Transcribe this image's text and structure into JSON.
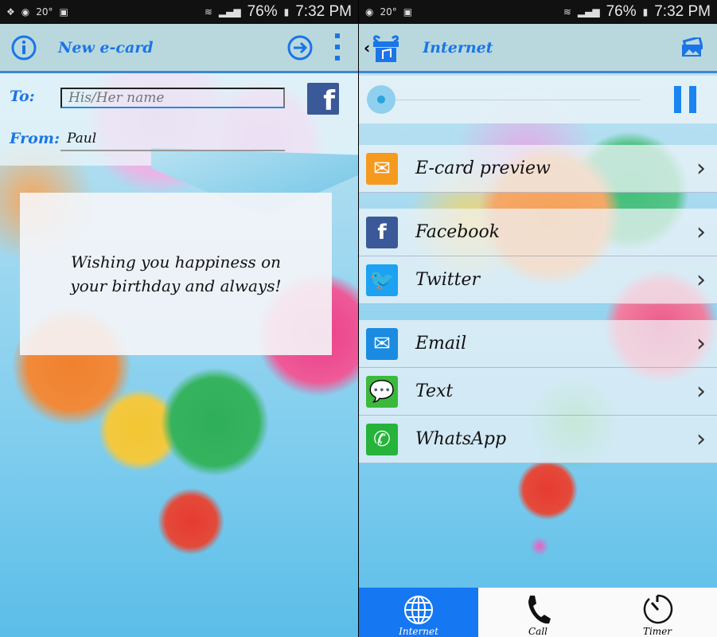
{
  "status_bar": {
    "temperature": "20°",
    "battery": "76%",
    "time": "7:32 PM"
  },
  "left": {
    "header": {
      "title": "New e-card"
    },
    "form": {
      "to_label": "To:",
      "to_placeholder": "His/Her name",
      "to_value": "",
      "from_label": "From:",
      "from_value": "Paul"
    },
    "card": {
      "message": "Wishing you happiness on your birthday and always!"
    }
  },
  "right": {
    "header": {
      "title": "Internet"
    },
    "player": {
      "progress": 0,
      "state": "playing"
    },
    "share_items": [
      {
        "label": "E-card preview",
        "icon": "envelope-open-icon",
        "color": "#f59a1e"
      },
      {
        "label": "Facebook",
        "icon": "facebook-icon",
        "color": "#3b5998"
      },
      {
        "label": "Twitter",
        "icon": "twitter-icon",
        "color": "#1da1f2"
      },
      {
        "label": "Email",
        "icon": "mail-icon",
        "color": "#1a8be0"
      },
      {
        "label": "Text",
        "icon": "message-icon",
        "color": "#3cb93c"
      },
      {
        "label": "WhatsApp",
        "icon": "whatsapp-icon",
        "color": "#25b33a"
      }
    ],
    "bottom_nav": [
      {
        "label": "Internet",
        "icon": "globe-icon",
        "active": true
      },
      {
        "label": "Call",
        "icon": "phone-icon",
        "active": false
      },
      {
        "label": "Timer",
        "icon": "timer-icon",
        "active": false
      }
    ]
  },
  "colors": {
    "accent": "#1a75e8",
    "appbar": "#b9d8de",
    "nav_active": "#1577f2"
  }
}
